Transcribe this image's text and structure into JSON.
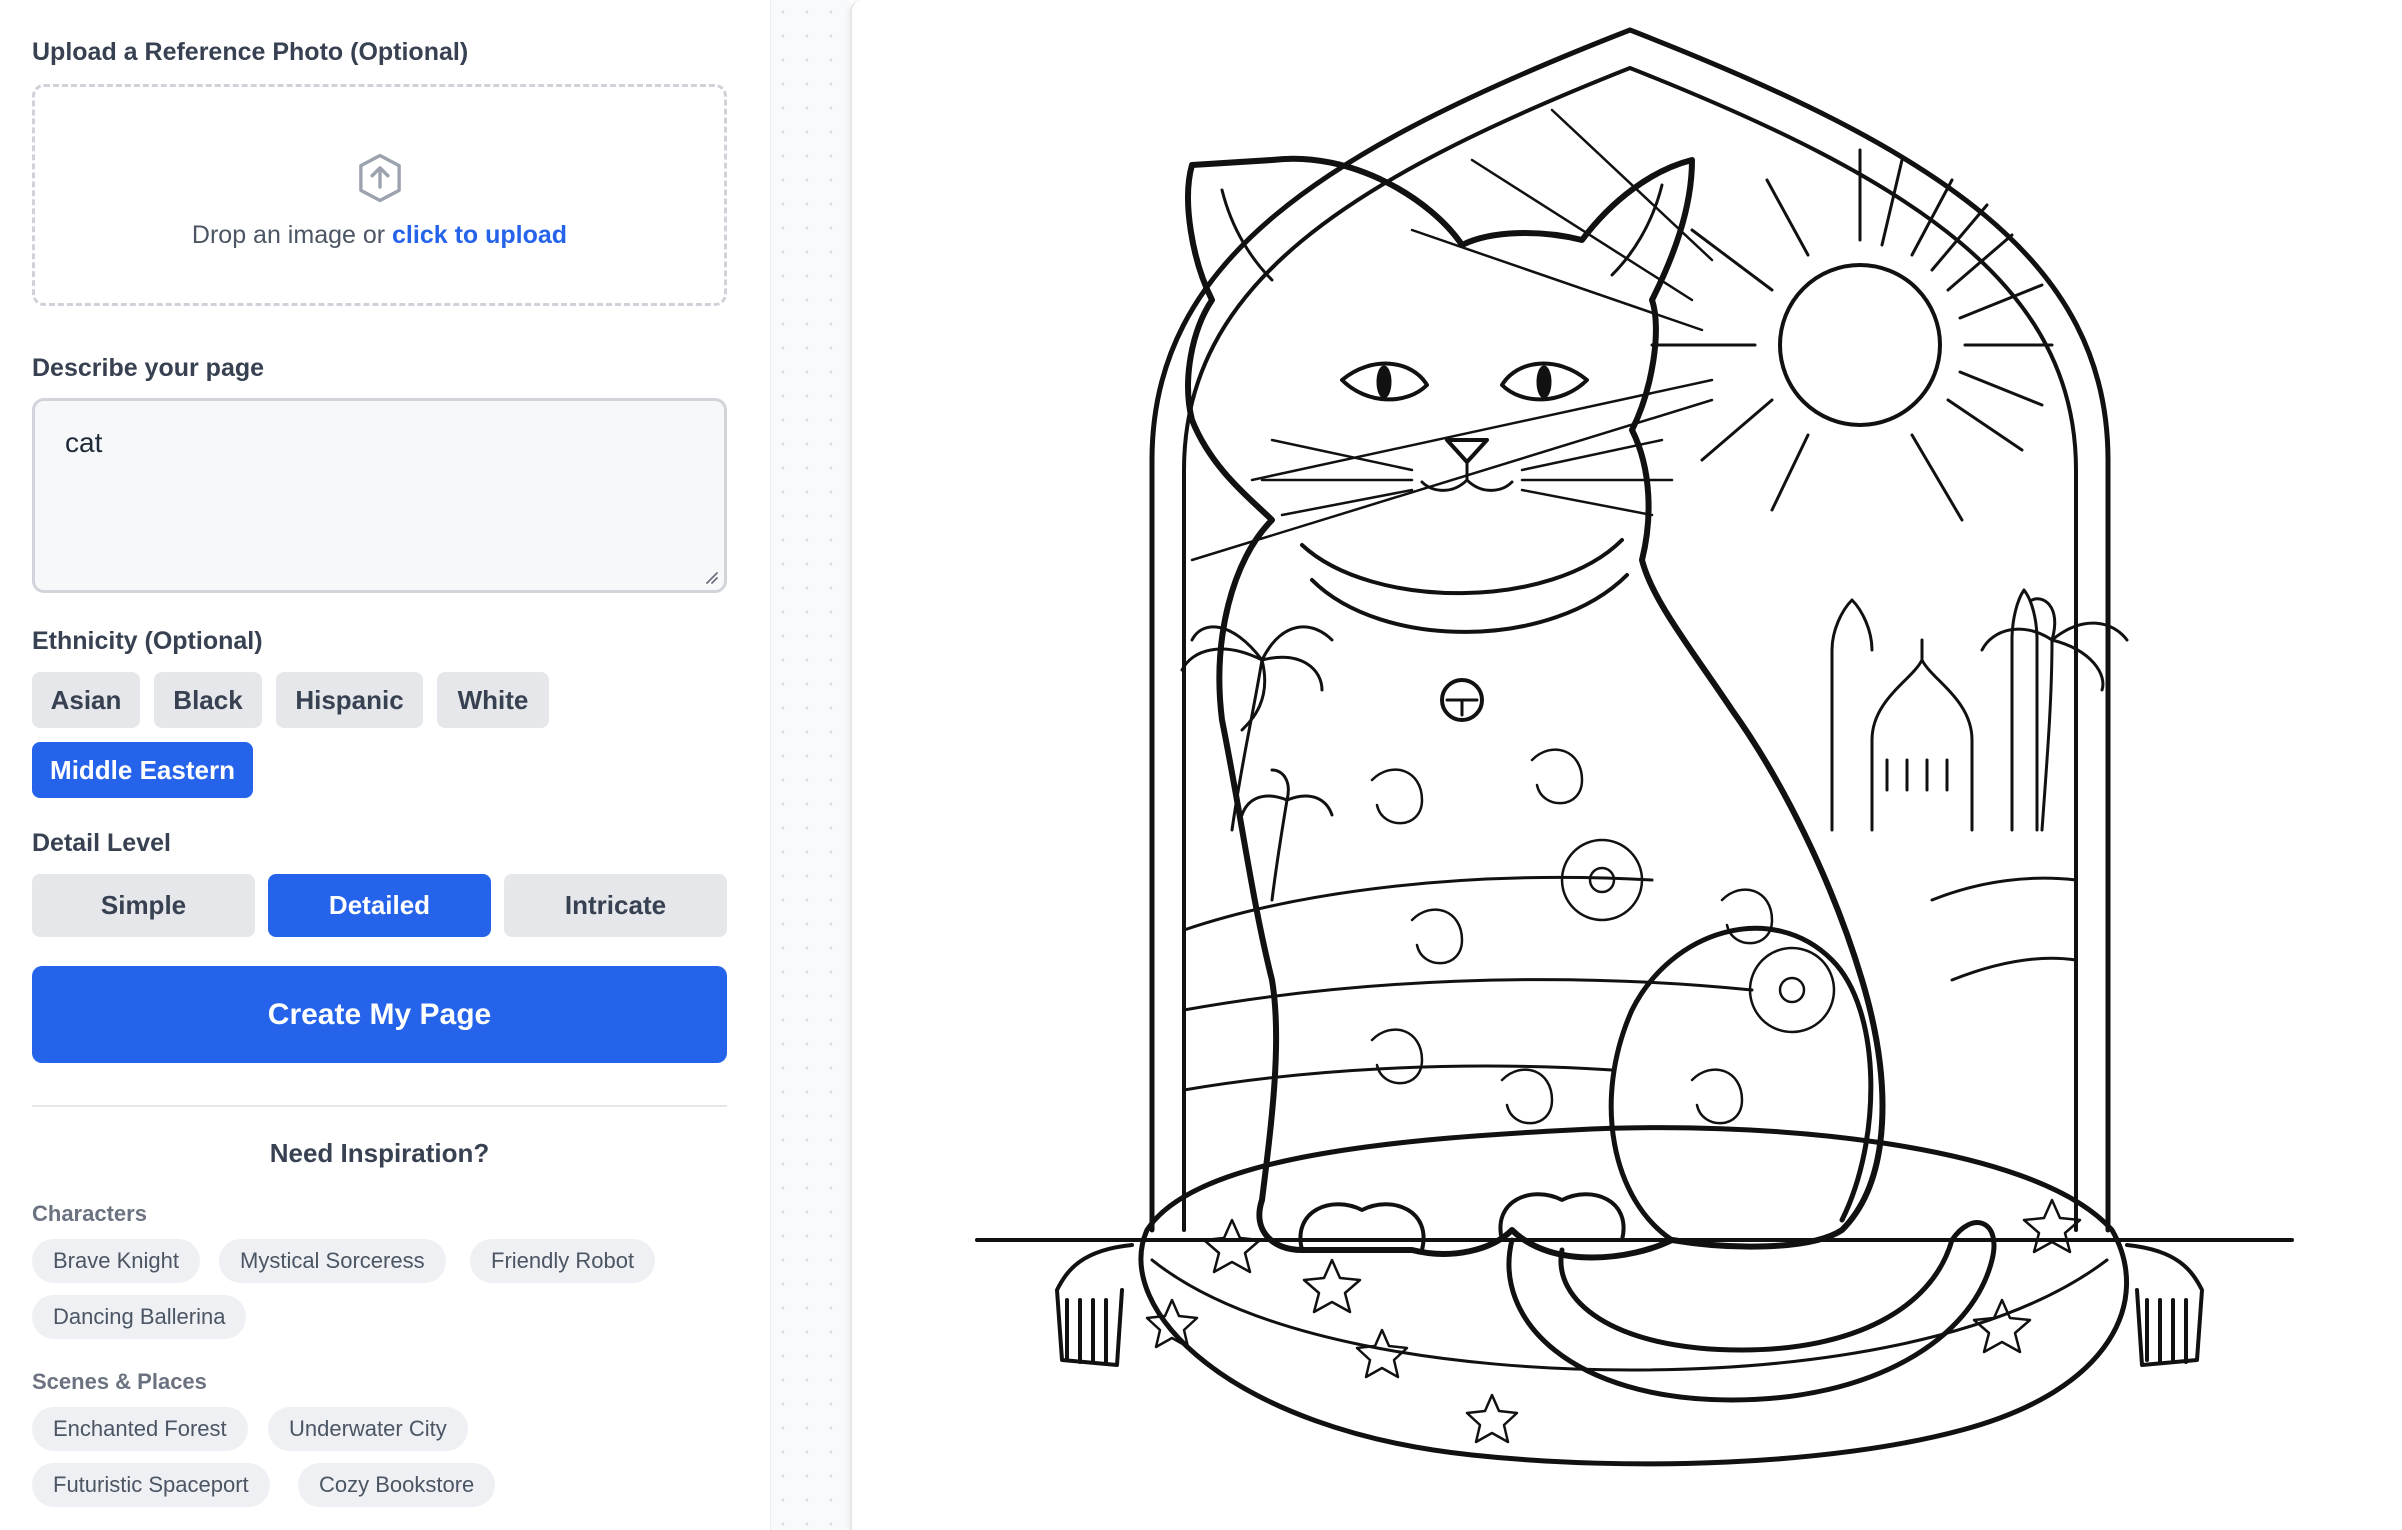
{
  "upload": {
    "label": "Upload a Reference Photo (Optional)",
    "drop_text": "Drop an image or ",
    "drop_link": "click to upload",
    "icon": "upload-icon"
  },
  "describe": {
    "label": "Describe your page",
    "value": "cat"
  },
  "ethnicity": {
    "label": "Ethnicity (Optional)",
    "options": [
      "Asian",
      "Black",
      "Hispanic",
      "White",
      "Middle Eastern"
    ],
    "selected": "Middle Eastern"
  },
  "detail": {
    "label": "Detail Level",
    "options": [
      "Simple",
      "Detailed",
      "Intricate"
    ],
    "selected": "Detailed"
  },
  "create_button": "Create My Page",
  "inspiration": {
    "title": "Need Inspiration?",
    "groups": [
      {
        "label": "Characters",
        "items": [
          "Brave Knight",
          "Mystical Sorceress",
          "Friendly Robot",
          "Dancing Ballerina"
        ]
      },
      {
        "label": "Scenes & Places",
        "items": [
          "Enchanted Forest",
          "Underwater City",
          "Futuristic Spaceport",
          "Cozy Bookstore"
        ]
      }
    ]
  },
  "colors": {
    "accent": "#2563eb",
    "chip_bg": "#e5e7eb",
    "pill_bg": "#eef0f3"
  },
  "preview": {
    "content": "coloring-page-cat-illustration"
  }
}
